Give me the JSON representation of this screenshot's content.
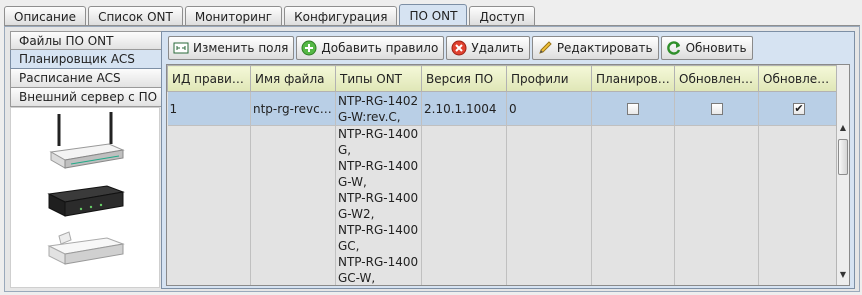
{
  "top_tabs": [
    "Описание",
    "Список ONT",
    "Мониторинг",
    "Конфигурация",
    "ПО ONT",
    "Доступ"
  ],
  "top_tab_active": "ПО ONT",
  "left_tabs": [
    "Файлы ПО ONT",
    "Планировщик ACS",
    "Расписание ACS",
    "Внешний сервер с ПО"
  ],
  "left_tab_active": "Планировщик ACS",
  "toolbar": {
    "edit_fields": "Изменить поля",
    "add_rule": "Добавить правило",
    "delete": "Удалить",
    "edit": "Редактировать",
    "refresh": "Обновить"
  },
  "table": {
    "columns": [
      "ИД правила",
      "Имя файла",
      "Типы ONT",
      "Версия ПО",
      "Профили",
      "Планировщ...",
      "Обновлени...",
      "Обновлени..."
    ],
    "rows": [
      {
        "id": "1",
        "file": "ntp-rg-revc-r...",
        "ont_types": [
          "NTP-RG-1402",
          "G-W:rev.C,"
        ],
        "version": "2.10.1.1004",
        "profiles": "0",
        "scheduler": false,
        "update1": false,
        "update2": true
      },
      {
        "id": "",
        "file": "",
        "ont_types": [
          "NTP-RG-1400",
          "G,",
          "NTP-RG-1400",
          "G-W,",
          "NTP-RG-1400",
          "G-W2,",
          "NTP-RG-1400",
          "GC,",
          "NTP-RG-1400",
          "GC-W,"
        ],
        "version": "",
        "profiles": "",
        "scheduler": null,
        "update1": null,
        "update2": null
      }
    ]
  },
  "colors": {
    "accent": "#d6e3f2",
    "header_bg": "#eef3c9",
    "selected_row": "#b9cfe6"
  }
}
